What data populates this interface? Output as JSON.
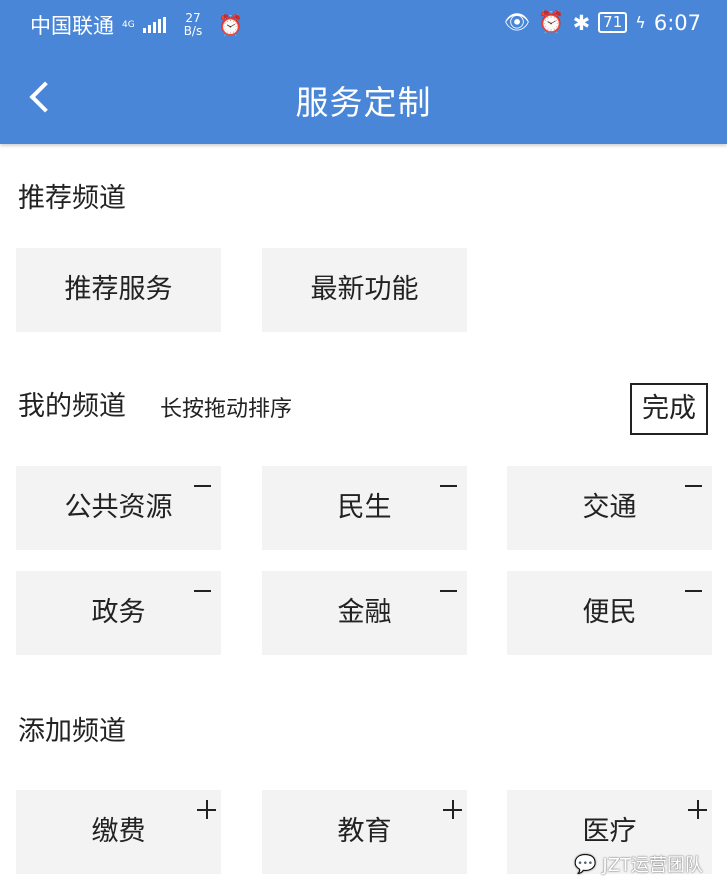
{
  "status_bar": {
    "carrier": "中国联通",
    "network": "4G",
    "net_sub": "≈",
    "speed_value": "27",
    "speed_unit": "B/s",
    "battery": "71",
    "time": "6:07"
  },
  "header": {
    "title": "服务定制"
  },
  "recommended": {
    "title": "推荐频道",
    "items": [
      "推荐服务",
      "最新功能"
    ]
  },
  "my_channels": {
    "title": "我的频道",
    "hint": "长按拖动排序",
    "done_label": "完成",
    "items": [
      "公共资源",
      "民生",
      "交通",
      "政务",
      "金融",
      "便民"
    ]
  },
  "add_channels": {
    "title": "添加频道",
    "items": [
      "缴费",
      "教育",
      "医疗"
    ]
  },
  "watermark": {
    "text": "JZT运营团队"
  },
  "colors": {
    "header_bg": "#4a86d8",
    "tile_bg": "#f3f3f3"
  }
}
